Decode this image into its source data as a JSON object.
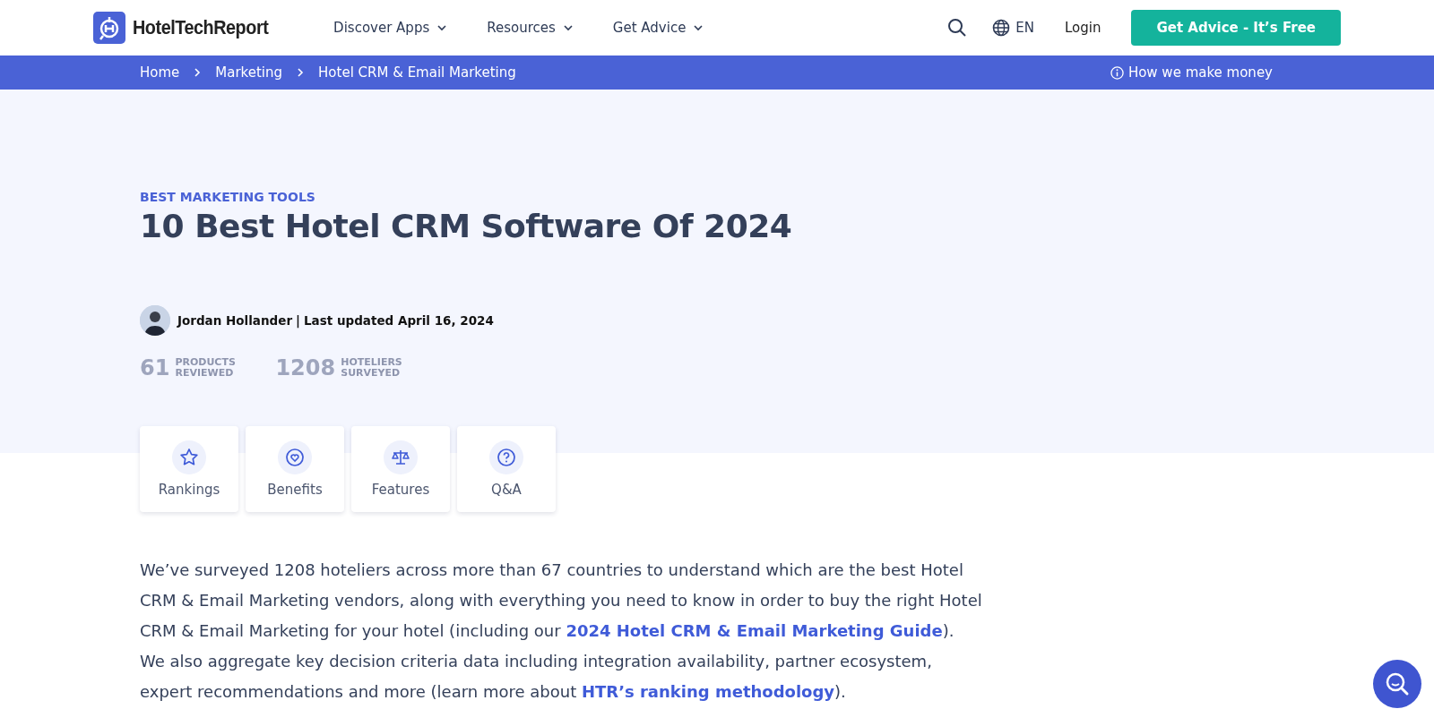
{
  "header": {
    "logo": "HotelTechReport",
    "nav": [
      {
        "label": "Discover Apps"
      },
      {
        "label": "Resources"
      },
      {
        "label": "Get Advice"
      }
    ],
    "language": "EN",
    "login": "Login",
    "cta": "Get Advice - It’s Free"
  },
  "breadcrumbs": [
    {
      "label": "Home"
    },
    {
      "label": "Marketing"
    },
    {
      "label": "Hotel CRM & Email Marketing"
    }
  ],
  "disclosure": "How we make money",
  "hero": {
    "eyebrow": "BEST MARKETING TOOLS",
    "title": "10 Best Hotel CRM Software Of 2024",
    "author": "Jordan Hollander",
    "separator": "|",
    "updated": "Last updated April 16, 2024",
    "stats": [
      {
        "value": "61",
        "label": "PRODUCTS REVIEWED"
      },
      {
        "value": "1208",
        "label": "HOTELIERS SURVEYED"
      }
    ]
  },
  "tabs": [
    {
      "label": "Rankings"
    },
    {
      "label": "Benefits"
    },
    {
      "label": "Features"
    },
    {
      "label": "Q&A"
    }
  ],
  "intro": [
    {
      "kind": "text",
      "text": "We’ve surveyed 1208 hoteliers across more than 67 countries to understand which are the best Hotel CRM & Email Marketing vendors, along with everything you need to know in order to buy the right Hotel CRM & Email Marketing for your hotel (including our "
    },
    {
      "kind": "link",
      "text": "2024 Hotel CRM & Email Marketing Guide"
    },
    {
      "kind": "text",
      "text": "). We also aggregate key decision criteria data including integration availability, partner ecosystem, expert recommendations and more (learn more about "
    },
    {
      "kind": "link",
      "text": "HTR’s ranking methodology"
    },
    {
      "kind": "text",
      "text": ")."
    }
  ]
}
